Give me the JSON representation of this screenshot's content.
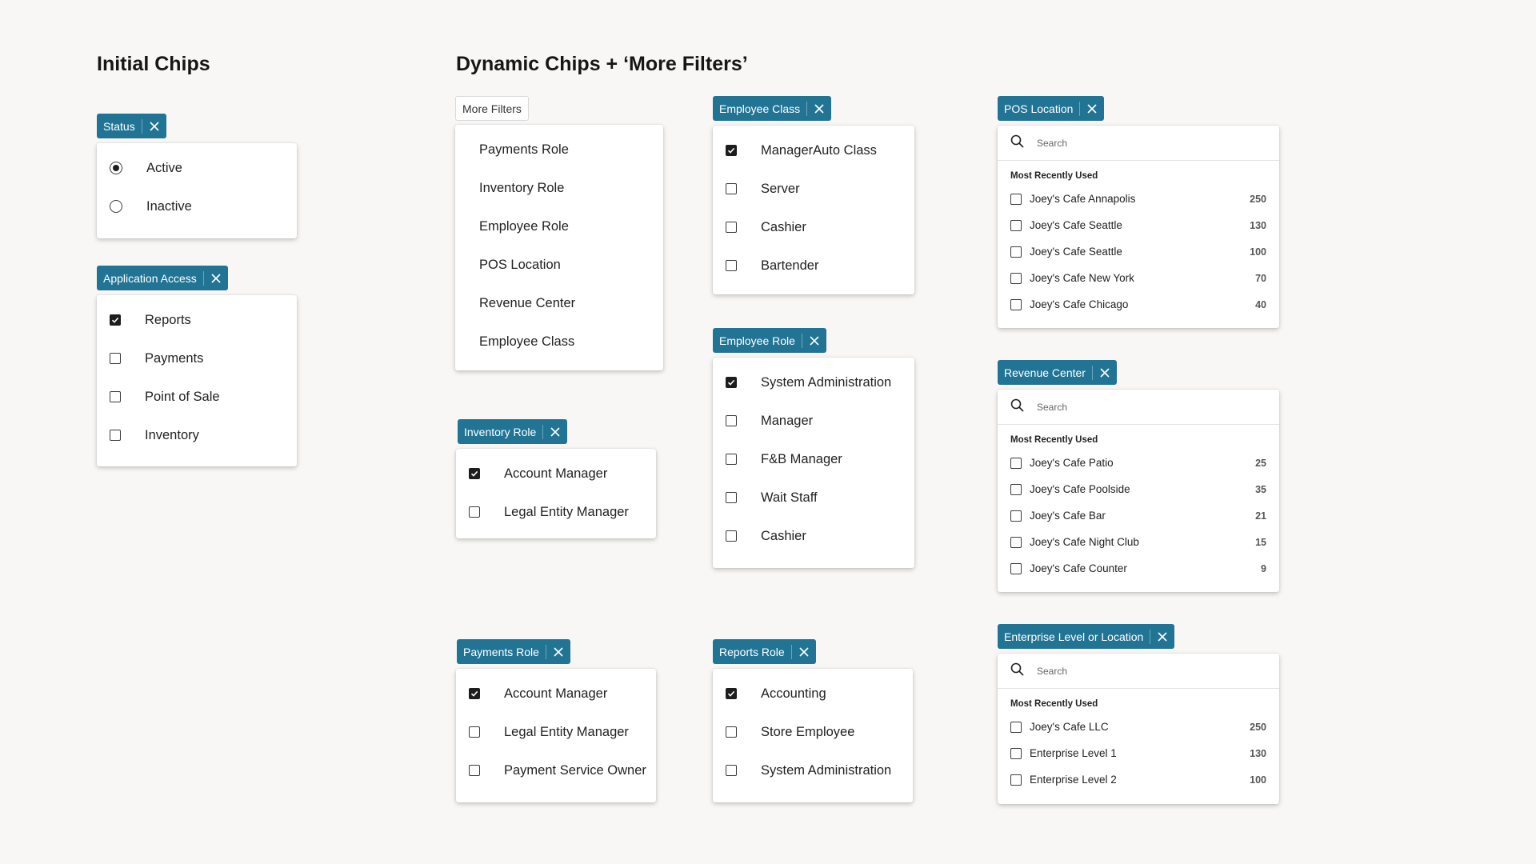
{
  "headings": {
    "initial": "Initial Chips",
    "dynamic": "Dynamic Chips + ‘More Filters’"
  },
  "icons": {
    "close": "close-icon",
    "search": "search-icon",
    "check": "check-icon"
  },
  "colors": {
    "chip_bg": "#227495",
    "page_bg": "#f8f7f5",
    "checkbox_on": "#1d1d1d"
  },
  "status": {
    "chip_label": "Status",
    "options": [
      {
        "label": "Active",
        "selected": true
      },
      {
        "label": "Inactive",
        "selected": false
      }
    ]
  },
  "application_access": {
    "chip_label": "Application Access",
    "options": [
      {
        "label": "Reports",
        "checked": true
      },
      {
        "label": "Payments",
        "checked": false
      },
      {
        "label": "Point of Sale",
        "checked": false
      },
      {
        "label": "Inventory",
        "checked": false
      }
    ]
  },
  "more_filters": {
    "chip_label": "More Filters",
    "items": [
      "Payments Role",
      "Inventory Role",
      "Employee Role",
      "POS Location",
      "Revenue Center",
      "Employee Class"
    ]
  },
  "inventory_role": {
    "chip_label": "Inventory Role",
    "options": [
      {
        "label": "Account Manager",
        "checked": true
      },
      {
        "label": "Legal Entity Manager",
        "checked": false
      }
    ]
  },
  "payments_role": {
    "chip_label": "Payments Role",
    "options": [
      {
        "label": "Account Manager",
        "checked": true
      },
      {
        "label": "Legal Entity Manager",
        "checked": false
      },
      {
        "label": "Payment Service Owner",
        "checked": false
      }
    ]
  },
  "employee_class": {
    "chip_label": "Employee Class",
    "options": [
      {
        "label": "ManagerAuto Class",
        "checked": true
      },
      {
        "label": "Server",
        "checked": false
      },
      {
        "label": "Cashier",
        "checked": false
      },
      {
        "label": "Bartender",
        "checked": false
      }
    ]
  },
  "employee_role": {
    "chip_label": "Employee Role",
    "options": [
      {
        "label": "System Administration",
        "checked": true
      },
      {
        "label": "Manager",
        "checked": false
      },
      {
        "label": "F&B Manager",
        "checked": false
      },
      {
        "label": "Wait Staff",
        "checked": false
      },
      {
        "label": "Cashier",
        "checked": false
      }
    ]
  },
  "reports_role": {
    "chip_label": "Reports Role",
    "options": [
      {
        "label": "Accounting",
        "checked": true
      },
      {
        "label": "Store Employee",
        "checked": false
      },
      {
        "label": "System Administration",
        "checked": false
      }
    ]
  },
  "pos_location": {
    "chip_label": "POS Location",
    "search_placeholder": "Search",
    "mru_title": "Most Recently Used",
    "rows": [
      {
        "name": "Joey's Cafe Annapolis",
        "count": "250",
        "checked": false
      },
      {
        "name": "Joey's Cafe Seattle",
        "count": "130",
        "checked": false
      },
      {
        "name": "Joey's Cafe Seattle",
        "count": "100",
        "checked": false
      },
      {
        "name": "Joey's Cafe New York",
        "count": "70",
        "checked": false
      },
      {
        "name": "Joey's Cafe Chicago",
        "count": "40",
        "checked": false
      }
    ]
  },
  "revenue_center": {
    "chip_label": "Revenue Center",
    "search_placeholder": "Search",
    "mru_title": "Most Recently Used",
    "rows": [
      {
        "name": "Joey's Cafe Patio",
        "count": "25",
        "checked": false
      },
      {
        "name": "Joey's Cafe Poolside",
        "count": "35",
        "checked": false
      },
      {
        "name": "Joey's Cafe Bar",
        "count": "21",
        "checked": false
      },
      {
        "name": "Joey's Cafe Night Club",
        "count": "15",
        "checked": false
      },
      {
        "name": "Joey's Cafe Counter",
        "count": "9",
        "checked": false
      }
    ]
  },
  "enterprise_level": {
    "chip_label": "Enterprise Level or Location",
    "search_placeholder": "Search",
    "mru_title": "Most Recently Used",
    "rows": [
      {
        "name": "Joey's Cafe LLC",
        "count": "250",
        "checked": false
      },
      {
        "name": "Enterprise Level 1",
        "count": "130",
        "checked": false
      },
      {
        "name": "Enterprise Level 2",
        "count": "100",
        "checked": false
      }
    ]
  }
}
